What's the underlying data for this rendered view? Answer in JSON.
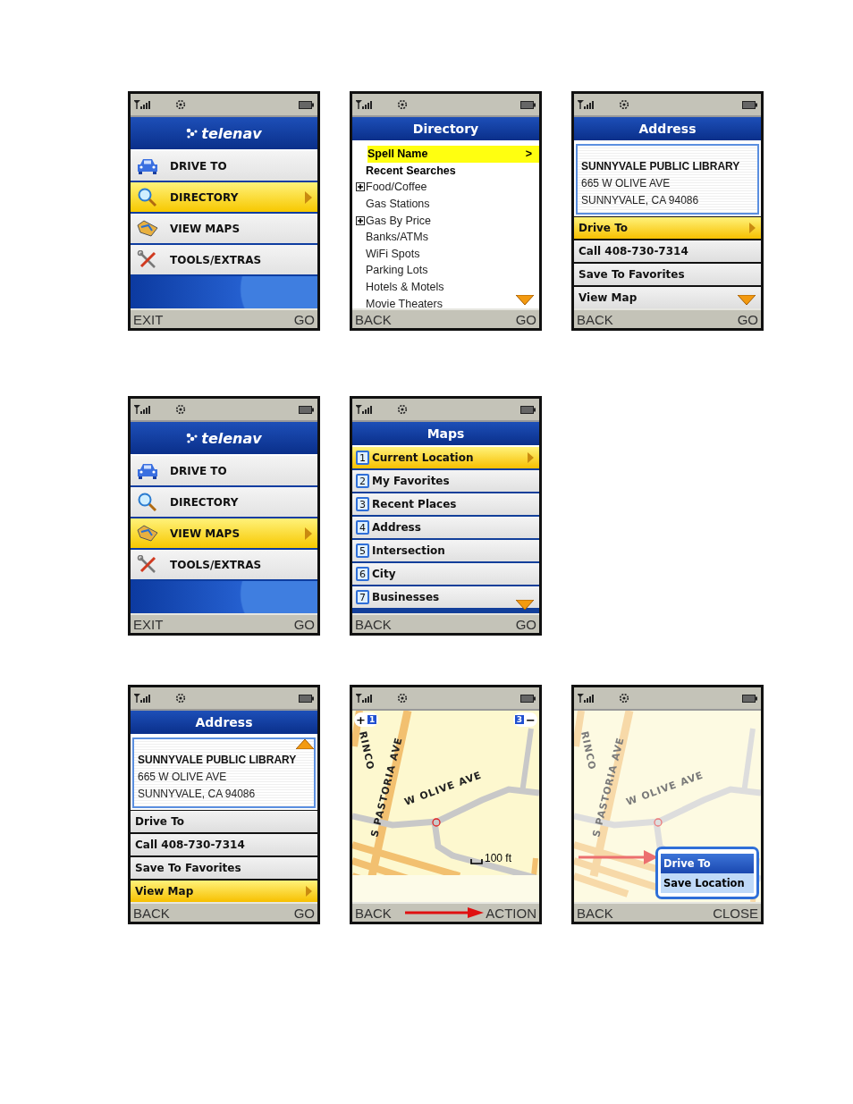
{
  "rows": [
    [
      {
        "kind": "menu",
        "logo": "telenav",
        "items": [
          {
            "label": "DRIVE TO",
            "selected": false
          },
          {
            "label": "DIRECTORY",
            "selected": true
          },
          {
            "label": "VIEW MAPS",
            "selected": false
          },
          {
            "label": "TOOLS/EXTRAS",
            "selected": false
          }
        ],
        "left": "EXIT",
        "right": "GO"
      },
      {
        "kind": "list",
        "title": "Directory",
        "items": [
          {
            "label": "Spell Name",
            "bold": true,
            "expandable": false,
            "selected": true,
            "chevron": ">"
          },
          {
            "label": "Recent Searches",
            "bold": true,
            "expandable": false,
            "selected": false
          },
          {
            "label": "Food/Coffee",
            "bold": false,
            "expandable": true,
            "selected": false
          },
          {
            "label": "Gas Stations",
            "bold": false,
            "expandable": false,
            "selected": false
          },
          {
            "label": "Gas By Price",
            "bold": false,
            "expandable": true,
            "selected": false
          },
          {
            "label": "Banks/ATMs",
            "bold": false,
            "expandable": false,
            "selected": false
          },
          {
            "label": "WiFi Spots",
            "bold": false,
            "expandable": false,
            "selected": false
          },
          {
            "label": "Parking Lots",
            "bold": false,
            "expandable": false,
            "selected": false
          },
          {
            "label": "Hotels & Motels",
            "bold": false,
            "expandable": false,
            "selected": false
          },
          {
            "label": "Movie Theaters",
            "bold": false,
            "expandable": false,
            "selected": false
          }
        ],
        "more_below": true,
        "left": "BACK",
        "right": "GO"
      },
      {
        "kind": "address",
        "title": "Address",
        "place": {
          "name": "SUNNYVALE PUBLIC LIBRARY",
          "street": "665 W OLIVE AVE",
          "city": "SUNNYVALE, CA 94086"
        },
        "items": [
          {
            "label": "Drive To",
            "selected": true
          },
          {
            "label": "Call 408-730-7314",
            "selected": false
          },
          {
            "label": "Save To Favorites",
            "selected": false
          },
          {
            "label": "View Map",
            "selected": false
          }
        ],
        "more_above": false,
        "more_below": true,
        "left": "BACK",
        "right": "GO"
      }
    ],
    [
      {
        "kind": "menu",
        "logo": "telenav",
        "items": [
          {
            "label": "DRIVE TO",
            "selected": false
          },
          {
            "label": "DIRECTORY",
            "selected": false
          },
          {
            "label": "VIEW MAPS",
            "selected": true
          },
          {
            "label": "TOOLS/EXTRAS",
            "selected": false
          }
        ],
        "left": "EXIT",
        "right": "GO"
      },
      {
        "kind": "numbered",
        "title": "Maps",
        "items": [
          {
            "number": "1",
            "label": "Current Location",
            "selected": true
          },
          {
            "number": "2",
            "label": "My Favorites",
            "selected": false
          },
          {
            "number": "3",
            "label": "Recent Places",
            "selected": false
          },
          {
            "number": "4",
            "label": "Address",
            "selected": false
          },
          {
            "number": "5",
            "label": "Intersection",
            "selected": false
          },
          {
            "number": "6",
            "label": "City",
            "selected": false
          },
          {
            "number": "7",
            "label": "Businesses",
            "selected": false
          }
        ],
        "more_below": true,
        "left": "BACK",
        "right": "GO"
      }
    ],
    [
      {
        "kind": "address",
        "title": "Address",
        "place": {
          "name": "SUNNYVALE PUBLIC LIBRARY",
          "street": "665 W OLIVE AVE",
          "city": "SUNNYVALE, CA 94086"
        },
        "items": [
          {
            "label": "Drive To",
            "selected": false
          },
          {
            "label": "Call 408-730-7314",
            "selected": false
          },
          {
            "label": "Save To Favorites",
            "selected": false
          },
          {
            "label": "View Map",
            "selected": true
          }
        ],
        "more_above": true,
        "more_below": false,
        "left": "BACK",
        "right": "GO"
      },
      {
        "kind": "map",
        "labels": [
          "RINCO",
          "S PASTORIA AVE",
          "W OLIVE AVE"
        ],
        "zoom_in_sign": "+",
        "zoom_in_level": "1",
        "zoom_out_level": "3",
        "zoom_out_sign": "−",
        "scale": "100 ft",
        "softkey_arrow": true,
        "left": "BACK",
        "right": "ACTION"
      },
      {
        "kind": "map_popup",
        "labels": [
          "RINCO",
          "S PASTORIA AVE",
          "W OLIVE AVE"
        ],
        "popup": [
          {
            "label": "Drive To",
            "selected": true
          },
          {
            "label": "Save Location",
            "selected": false
          }
        ],
        "left": "BACK",
        "right": "CLOSE"
      }
    ]
  ]
}
